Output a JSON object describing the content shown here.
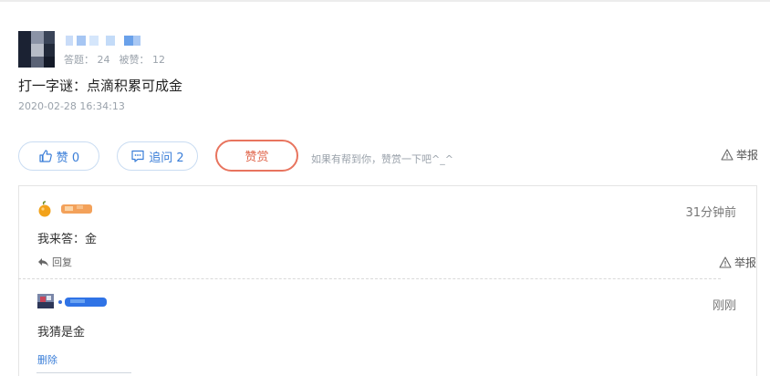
{
  "author": {
    "stats_answers": "答题： 24",
    "stats_likes": "被赞： 12"
  },
  "question": {
    "title": "打一字谜：点滴积累可成金",
    "time": "2020-02-28 16:34:13"
  },
  "actions": {
    "like_label": "赞 0",
    "ask_label": "追问 2",
    "reward_label": "赞赏",
    "reward_hint": "如果有帮到你，赞赏一下吧^_^",
    "report_label": "举报"
  },
  "comments": [
    {
      "time": "31分钟前",
      "text": "我来答：金",
      "action_label": "回复",
      "report_label": "举报"
    },
    {
      "time": "刚刚",
      "text": "我猜是金",
      "action_label": "删除"
    }
  ],
  "colors": {
    "accent": "#3a7ed8",
    "reward": "#e0664c",
    "muted": "#9aa2ab"
  },
  "icons": {
    "like": "thumbs-up-icon",
    "ask": "chat-bubble-icon",
    "report": "warning-triangle-icon",
    "reply": "reply-arrow-icon"
  }
}
